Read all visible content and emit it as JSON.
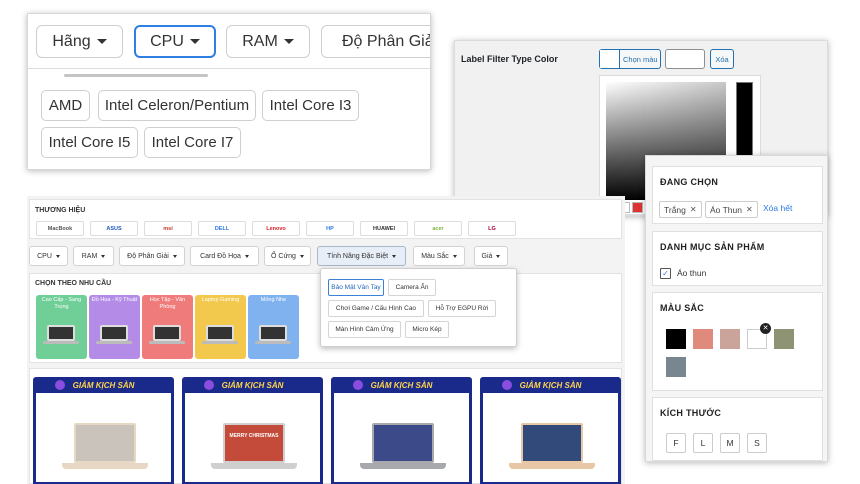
{
  "product_filter_tabs": {
    "tabs": [
      {
        "label": "Hãng",
        "active": false
      },
      {
        "label": "CPU",
        "active": true
      },
      {
        "label": "RAM",
        "active": false
      },
      {
        "label": "Độ Phân Giả",
        "active": false
      }
    ],
    "chips": [
      "AMD",
      "Intel Celeron/Pentium",
      "Intel Core I3",
      "Intel Core I5",
      "Intel Core I7"
    ]
  },
  "color_option": {
    "title": "Label Filter Type Color",
    "choose_button": "Chọn màu",
    "hex_value": "",
    "clear_button": "Xóa",
    "palette": [
      "#000000",
      "#ffffff",
      "#dd3333",
      "#dd9933",
      "#eeee22",
      "#81d742",
      "#1e73be",
      "#8224e3"
    ]
  },
  "store": {
    "brands_title": "THƯƠNG HIỆU",
    "brands": [
      "MacBook",
      "ASUS",
      "msi",
      "DELL",
      "Lenovo",
      "HP",
      "HUAWEI",
      "acer",
      "LG"
    ],
    "filters": [
      "CPU",
      "RAM",
      "Độ Phân Giải",
      "Card Đồ Họa",
      "Ổ Cứng",
      "Tính Năng Đặc Biệt",
      "Màu Sắc",
      "Giá"
    ],
    "open_filter": "Tính Năng Đặc Biệt",
    "needs_title": "CHỌN THEO NHU CẦU",
    "needs": [
      {
        "label": "Cao Cấp - Sang Trọng",
        "color": "#6fcf97"
      },
      {
        "label": "Đồ Họa - Kỹ Thuật",
        "color": "#b58be8"
      },
      {
        "label": "Học Tập - Văn Phòng",
        "color": "#ef7b7b"
      },
      {
        "label": "Laptop Gaming",
        "color": "#f2c94c"
      },
      {
        "label": "Mỏng Nhẹ",
        "color": "#7fb2ee"
      }
    ],
    "feature_options": [
      "Bảo Mật Vân Tay",
      "Camera Ẩn",
      "Chơi Game / Cấu Hình Cao",
      "Hỗ Trợ EGPU Rời",
      "Màn Hình Cảm Ứng",
      "Micro Kép"
    ],
    "selected_option": "Bảo Mật Vân Tay",
    "promo_label": "GIẢM KỊCH SÀN",
    "xmas_text": "MERRY CHRISTMAS",
    "products": [
      {
        "screen": "#c9c3bb",
        "body": "#e6d8c3"
      },
      {
        "screen": "#c44b3a",
        "body": "#cfcfcf"
      },
      {
        "screen": "#3c4a8a",
        "body": "#a7a9ad"
      },
      {
        "screen": "#314a7a",
        "body": "#e8c7a7"
      }
    ]
  },
  "sidebar": {
    "selected_title": "ĐANG CHỌN",
    "selected_tags": [
      "Trắng",
      "Áo Thun"
    ],
    "clear_all": "Xóa hết",
    "category_title": "DANH MỤC SẢN PHẨM",
    "category_item": "Áo thun",
    "category_checked": true,
    "color_title": "MÀU SẮC",
    "colors": [
      "#000000",
      "#e0897d",
      "#caa49b",
      "#ffffff",
      "#8e9373",
      "#78878f"
    ],
    "selected_color": "#ffffff",
    "size_title": "KÍCH THƯỚC",
    "sizes": [
      "F",
      "L",
      "M",
      "S"
    ]
  }
}
